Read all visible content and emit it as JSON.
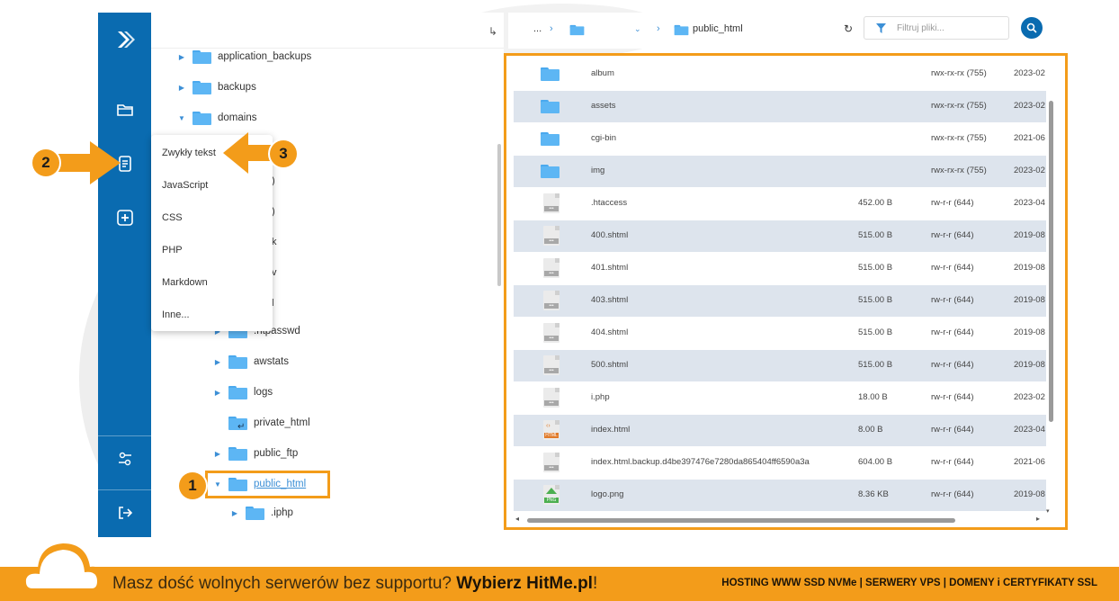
{
  "tree": {
    "items": [
      {
        "label": "application_backups",
        "toggle": "▶"
      },
      {
        "label": "backups",
        "toggle": "▶"
      },
      {
        "label": "domains",
        "toggle": "▼"
      },
      {
        "label": ".htpasswd",
        "toggle": "▶"
      },
      {
        "label": "awstats",
        "toggle": "▶"
      },
      {
        "label": "logs",
        "toggle": "▶"
      },
      {
        "label": "private_html",
        "toggle": ""
      },
      {
        "label": "public_ftp",
        "toggle": "▶"
      },
      {
        "label": "public_html",
        "toggle": "▼"
      },
      {
        "label": ".iphp",
        "toggle": "▶"
      }
    ],
    "partial": [
      ")",
      ")",
      "k",
      "v",
      "ol"
    ]
  },
  "menu": {
    "items": [
      "Zwykły tekst",
      "JavaScript",
      "CSS",
      "PHP",
      "Markdown",
      "Inne..."
    ]
  },
  "header": {
    "ellipsis": "...",
    "current": "public_html",
    "filter_placeholder": "Filtruj pliki..."
  },
  "files": [
    {
      "name": "album",
      "size": "",
      "perms": "rwx-rx-rx (755)",
      "date": "2023-02",
      "type": "folder"
    },
    {
      "name": "assets",
      "size": "",
      "perms": "rwx-rx-rx (755)",
      "date": "2023-02",
      "type": "folder"
    },
    {
      "name": "cgi-bin",
      "size": "",
      "perms": "rwx-rx-rx (755)",
      "date": "2021-06",
      "type": "folder"
    },
    {
      "name": "img",
      "size": "",
      "perms": "rwx-rx-rx (755)",
      "date": "2023-02",
      "type": "folder"
    },
    {
      "name": ".htaccess",
      "size": "452.00 B",
      "perms": "rw-r-r (644)",
      "date": "2023-04",
      "type": "file"
    },
    {
      "name": "400.shtml",
      "size": "515.00 B",
      "perms": "rw-r-r (644)",
      "date": "2019-08",
      "type": "file"
    },
    {
      "name": "401.shtml",
      "size": "515.00 B",
      "perms": "rw-r-r (644)",
      "date": "2019-08",
      "type": "file"
    },
    {
      "name": "403.shtml",
      "size": "515.00 B",
      "perms": "rw-r-r (644)",
      "date": "2019-08",
      "type": "file"
    },
    {
      "name": "404.shtml",
      "size": "515.00 B",
      "perms": "rw-r-r (644)",
      "date": "2019-08",
      "type": "file"
    },
    {
      "name": "500.shtml",
      "size": "515.00 B",
      "perms": "rw-r-r (644)",
      "date": "2019-08",
      "type": "file"
    },
    {
      "name": "i.php",
      "size": "18.00 B",
      "perms": "rw-r-r (644)",
      "date": "2023-02",
      "type": "file"
    },
    {
      "name": "index.html",
      "size": "8.00 B",
      "perms": "rw-r-r (644)",
      "date": "2023-04",
      "type": "html"
    },
    {
      "name": "index.html.backup.d4be397476e7280da865404ff6590a3a",
      "size": "604.00 B",
      "perms": "rw-r-r (644)",
      "date": "2021-06",
      "type": "file"
    },
    {
      "name": "logo.png",
      "size": "8.36 KB",
      "perms": "rw-r-r (644)",
      "date": "2019-08",
      "type": "png"
    }
  ],
  "file_icon_labels": {
    "html": "HTML",
    "png": "PNG"
  },
  "callouts": [
    "1",
    "2",
    "3"
  ],
  "banner": {
    "text_before": "Masz dość wolnych serwerów bez supportu? ",
    "text_bold": "Wybierz HitMe.pl",
    "text_after": "!",
    "right": "HOSTING WWW SSD NVMe | SERWERY VPS | DOMENY i CERTYFIKATY SSL"
  },
  "colors": {
    "sidebar": "#0a6bb0",
    "accent": "#f39c1a",
    "folder": "#5db6f4",
    "row_alt": "#dde4ed"
  }
}
